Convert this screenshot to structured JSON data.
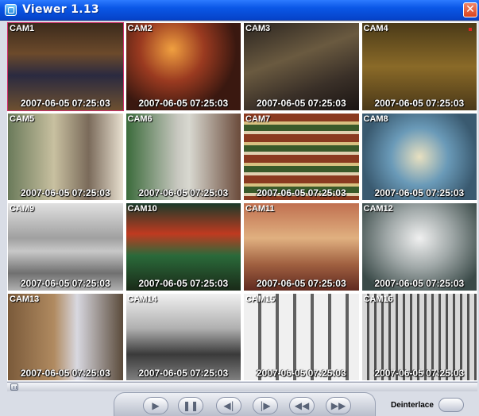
{
  "window": {
    "title": "Viewer 1.13"
  },
  "cameras": [
    {
      "label": "CAM1",
      "timestamp": "2007-06-05 07:25:03"
    },
    {
      "label": "CAM2",
      "timestamp": "2007-06-05 07:25:03"
    },
    {
      "label": "CAM3",
      "timestamp": "2007-06-05 07:25:03"
    },
    {
      "label": "CAM4",
      "timestamp": "2007-06-05 07:25:03"
    },
    {
      "label": "CAM5",
      "timestamp": "2007-06-05 07:25:03"
    },
    {
      "label": "CAM6",
      "timestamp": "2007-06-05 07:25:03"
    },
    {
      "label": "CAM7",
      "timestamp": "2007-06-05 07:25:03"
    },
    {
      "label": "CAM8",
      "timestamp": "2007-06-05 07:25:03"
    },
    {
      "label": "CAM9",
      "timestamp": "2007-06-05 07:25:03"
    },
    {
      "label": "CAM10",
      "timestamp": "2007-06-05 07:25:03"
    },
    {
      "label": "CAM11",
      "timestamp": "2007-06-05 07:25:03"
    },
    {
      "label": "CAM12",
      "timestamp": "2007-06-05 07:25:03"
    },
    {
      "label": "CAM13",
      "timestamp": "2007-06-05 07:25:03"
    },
    {
      "label": "CAM14",
      "timestamp": "2007-06-05 07:25:03"
    },
    {
      "label": "CAM15",
      "timestamp": "2007-06-05 07:25:03"
    },
    {
      "label": "CAM16",
      "timestamp": "2007-06-05 07:25:03"
    }
  ],
  "playback": {
    "position": 0,
    "buttons": [
      {
        "name": "play-icon"
      },
      {
        "name": "pause-icon"
      },
      {
        "name": "step-back-icon"
      },
      {
        "name": "step-forward-icon"
      },
      {
        "name": "rewind-icon"
      },
      {
        "name": "fast-forward-icon"
      }
    ]
  },
  "deinterlace": {
    "label": "Deinterlace"
  },
  "colors": {
    "titlebar": "#0a57e6",
    "selected_border": "#d12f6b",
    "close": "#d9431e"
  }
}
